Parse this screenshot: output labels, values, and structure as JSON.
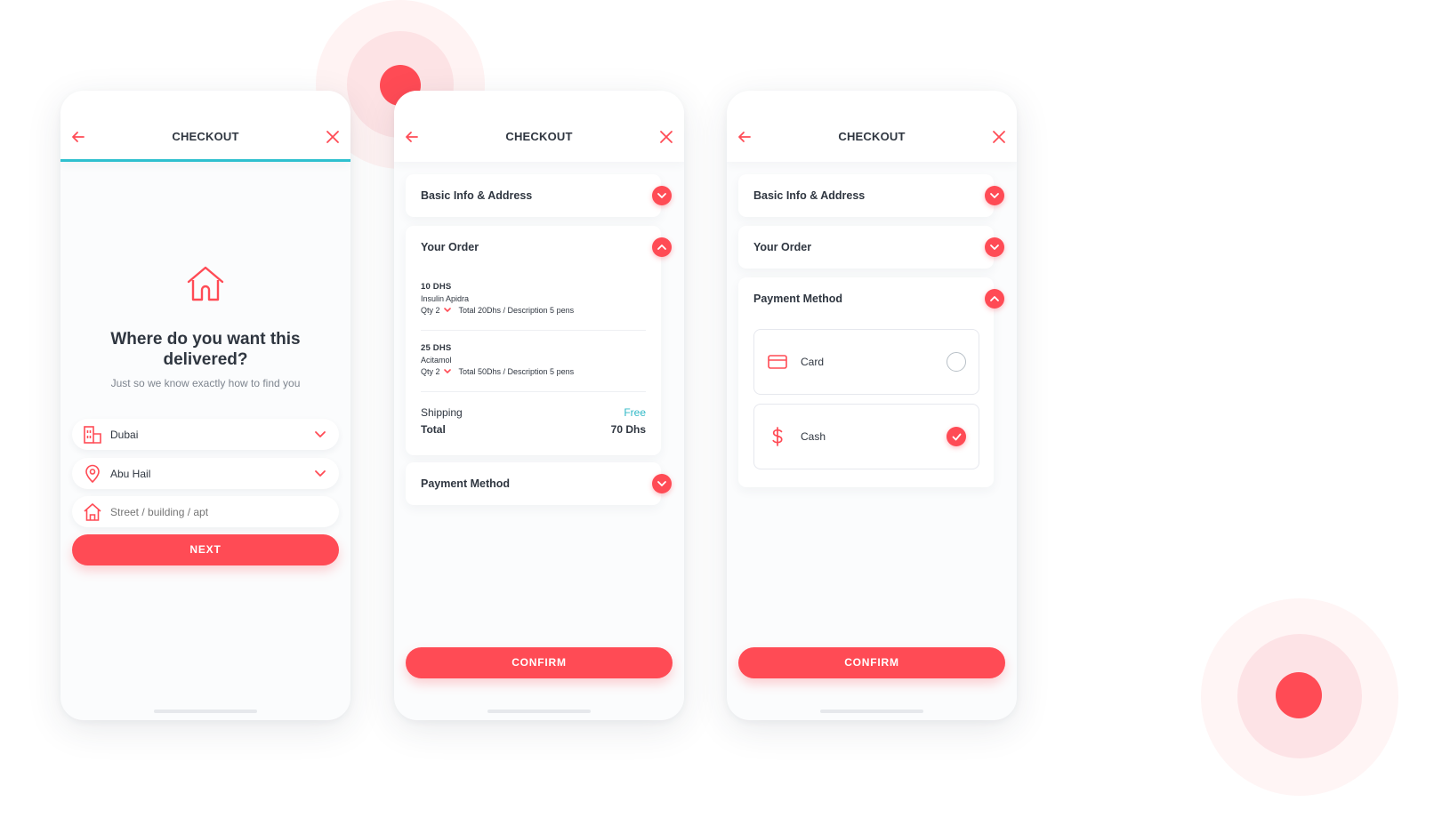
{
  "theme": {
    "accent": "#ff4b55",
    "teal": "#2fc0cf",
    "text": "#2f3640",
    "muted": "#7e858f"
  },
  "screens": [
    {
      "header": {
        "title": "CHECKOUT",
        "back_icon": "arrow-left-icon",
        "close_icon": "close-icon"
      },
      "progress": 1.0,
      "hero": {
        "icon": "house-icon",
        "title": "Where do you want this delivered?",
        "subtitle": "Just so we know exactly how to find you"
      },
      "fields": [
        {
          "icon": "building-icon",
          "value": "Dubai",
          "type": "select"
        },
        {
          "icon": "location-pin-icon",
          "value": "Abu Hail",
          "type": "select"
        },
        {
          "icon": "home-icon",
          "placeholder": "Street / building / apt",
          "value": "",
          "type": "text"
        }
      ],
      "next_label": "NEXT"
    },
    {
      "header": {
        "title": "CHECKOUT",
        "back_icon": "arrow-left-icon",
        "close_icon": "close-icon"
      },
      "sections": [
        {
          "title": "Basic Info & Address",
          "state": "collapsed"
        },
        {
          "title": "Your Order",
          "state": "expanded"
        },
        {
          "title": "Payment Method",
          "state": "collapsed"
        }
      ],
      "order": {
        "items": [
          {
            "price": "10 DHS",
            "name": "Insulin Apidra",
            "qty": "Qty 2",
            "details": "Total 20Dhs / Description 5 pens"
          },
          {
            "price": "25 DHS",
            "name": "Acitamol",
            "qty": "Qty 2",
            "details": "Total 50Dhs / Description 5 pens"
          }
        ],
        "shipping_label": "Shipping",
        "shipping_value": "Free",
        "total_label": "Total",
        "total_value": "70 Dhs"
      },
      "confirm_label": "CONFIRM"
    },
    {
      "header": {
        "title": "CHECKOUT",
        "back_icon": "arrow-left-icon",
        "close_icon": "close-icon"
      },
      "sections": [
        {
          "title": "Basic Info & Address",
          "state": "collapsed"
        },
        {
          "title": "Your Order",
          "state": "collapsed"
        },
        {
          "title": "Payment Method",
          "state": "expanded"
        }
      ],
      "payment_options": [
        {
          "icon": "credit-card-icon",
          "label": "Card",
          "selected": false
        },
        {
          "icon": "dollar-icon",
          "label": "Cash",
          "selected": true
        }
      ],
      "confirm_label": "CONFIRM"
    }
  ]
}
